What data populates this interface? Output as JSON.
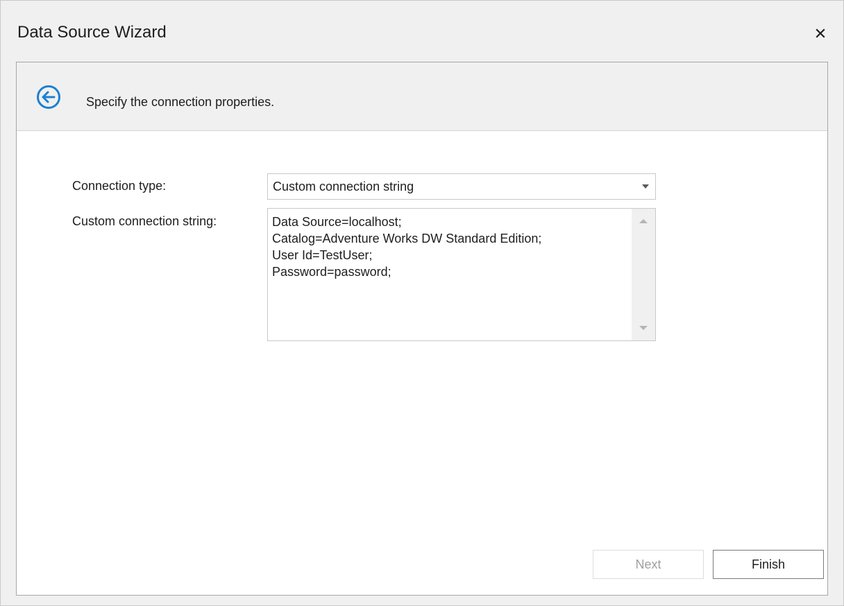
{
  "window": {
    "title": "Data Source Wizard",
    "close_icon": "close-icon"
  },
  "header": {
    "back_icon": "back-arrow-circle-icon",
    "text": "Specify the connection properties."
  },
  "form": {
    "connection_type_label": "Connection type:",
    "connection_type_value": "Custom connection string",
    "connection_string_label": "Custom connection string:",
    "connection_string_value": "Data Source=localhost;\nCatalog=Adventure Works DW Standard Edition;\nUser Id=TestUser;\nPassword=password;"
  },
  "footer": {
    "next_label": "Next",
    "finish_label": "Finish"
  },
  "colors": {
    "accent": "#1d7fd1",
    "window_bg": "#f0f0f0",
    "content_bg": "#ffffff",
    "disabled_text": "#a0a0a0"
  }
}
